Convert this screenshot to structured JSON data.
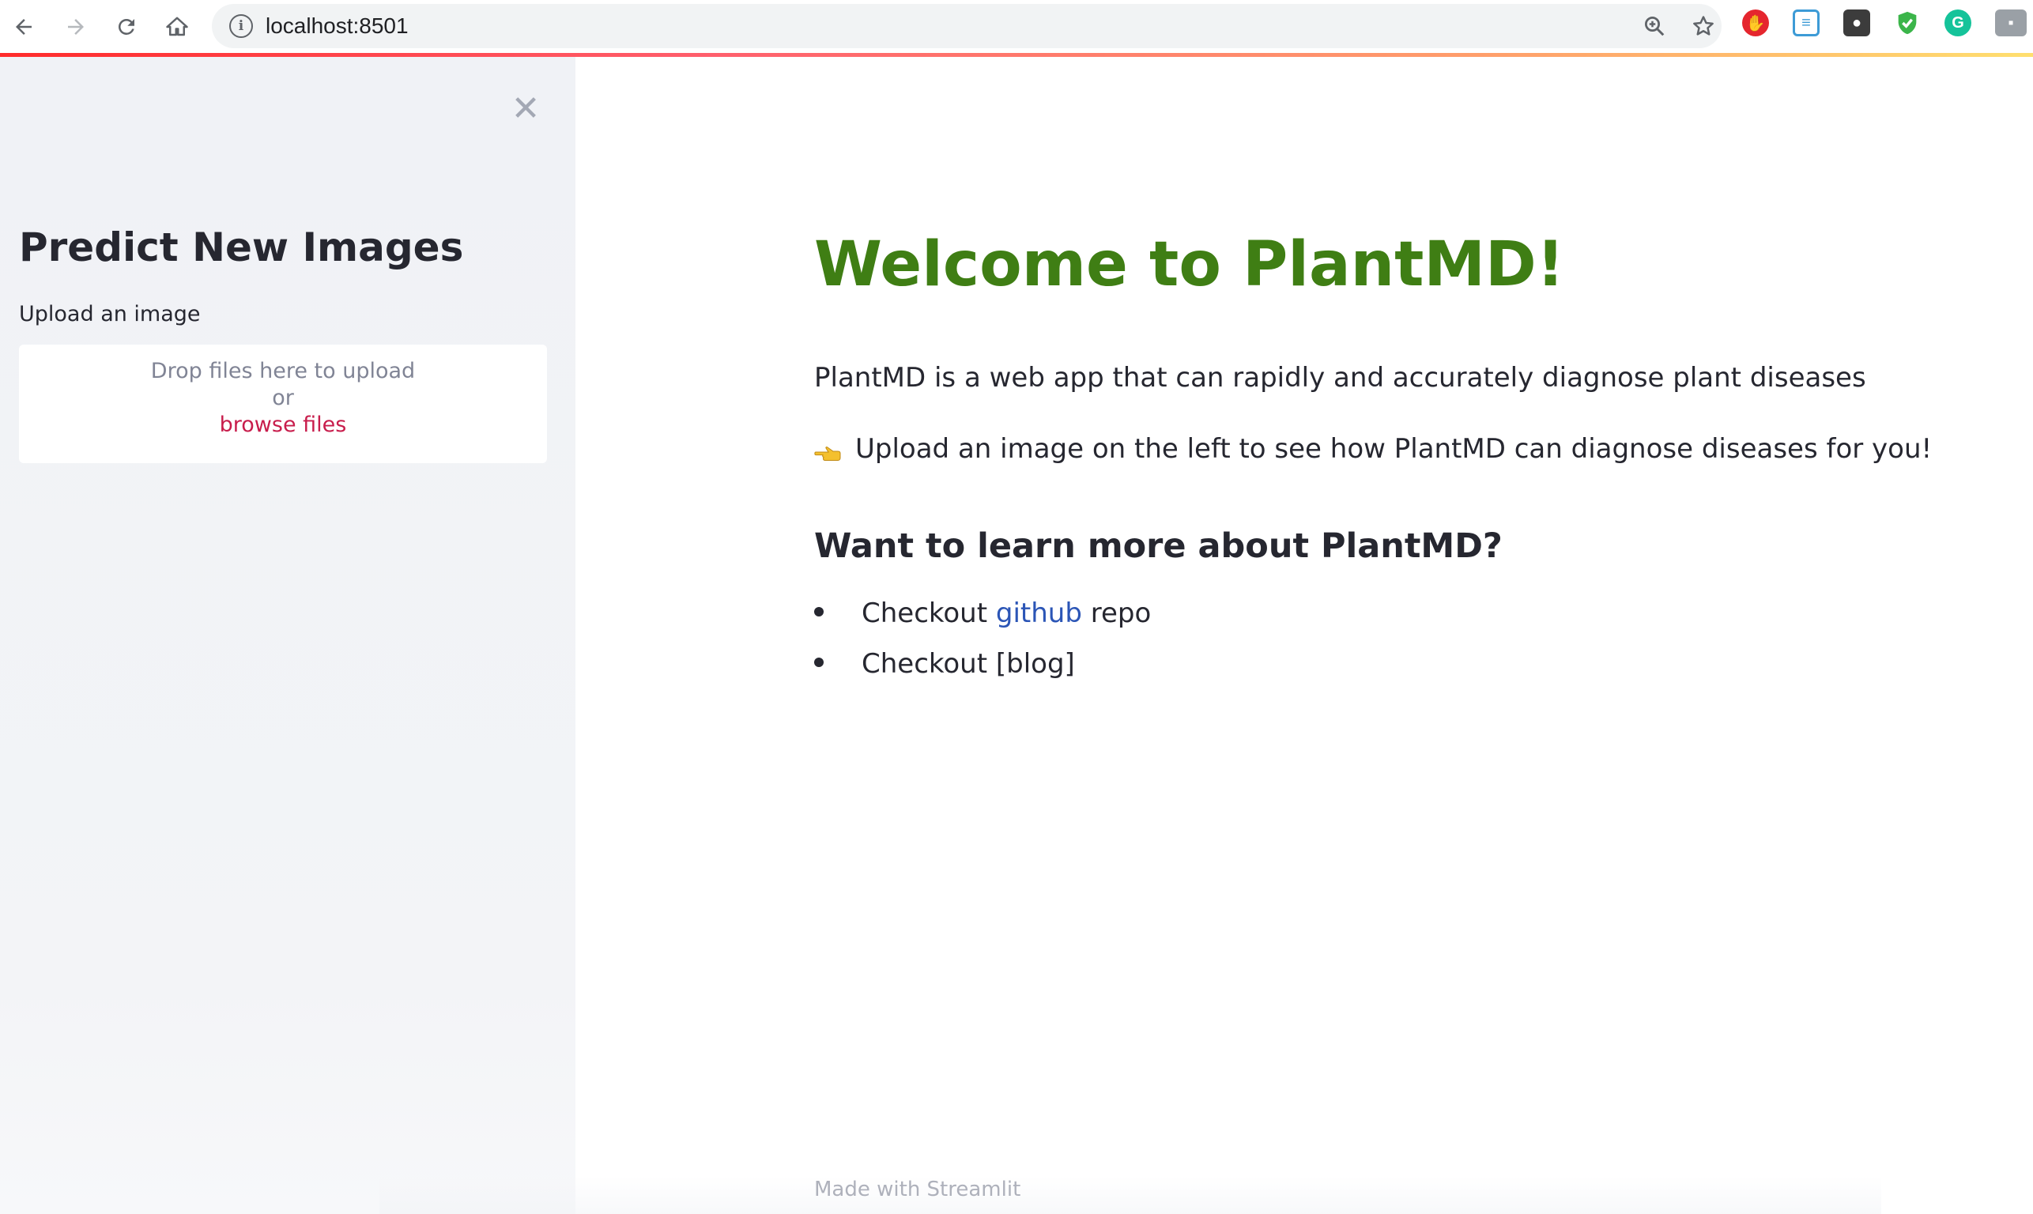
{
  "browser": {
    "url": "localhost:8501",
    "icons": [
      "back-arrow-icon",
      "forward-arrow-icon",
      "reload-icon",
      "home-icon",
      "info-icon",
      "zoom-icon",
      "star-icon"
    ],
    "extensions": [
      {
        "name": "adblock-extension-icon",
        "color": "#e5262e"
      },
      {
        "name": "reader-extension-icon",
        "color": "#3d9bd6"
      },
      {
        "name": "lightbulb-extension-icon",
        "color": "#3c3c3c"
      },
      {
        "name": "shield-extension-icon",
        "color": "#3bb54a"
      },
      {
        "name": "grammarly-extension-icon",
        "color": "#15c39a"
      },
      {
        "name": "chat-extension-icon",
        "color": "#9aa0a6"
      }
    ]
  },
  "sidebar": {
    "title": "Predict New Images",
    "upload_label": "Upload an image",
    "dropzone": {
      "instruction": "Drop files here to upload",
      "or": "or",
      "browse": "browse files"
    }
  },
  "main": {
    "title": "Welcome to PlantMD!",
    "description": "PlantMD is a web app that can rapidly and accurately diagnose plant diseases",
    "upload_hint": "Upload an image on the left to see how PlantMD can diagnose diseases for you!",
    "section_title": "Want to learn more about PlantMD?",
    "links": [
      {
        "prefix": "Checkout ",
        "link": "github",
        "suffix": " repo"
      },
      {
        "prefix": "Checkout [blog]",
        "link": "",
        "suffix": ""
      }
    ],
    "footer": "Made with Streamlit"
  },
  "colors": {
    "title_green": "#3f7e14",
    "link_blue": "#2b55b6",
    "browse_red": "#c81d4c",
    "sidebar_bg": "#f0f2f6"
  }
}
